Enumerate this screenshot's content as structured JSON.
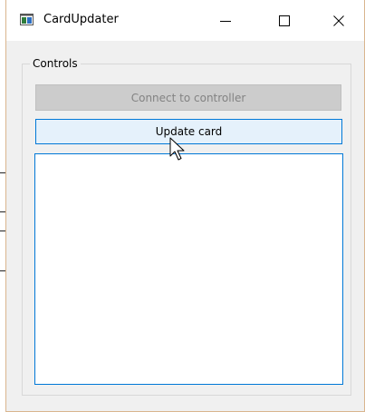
{
  "window": {
    "title": "CardUpdater",
    "icons": {
      "app": "app-window-icon",
      "minimize": "minimize-icon",
      "maximize": "maximize-icon",
      "close": "close-icon",
      "cursor": "mouse-pointer-icon"
    }
  },
  "controls": {
    "group_title": "Controls",
    "connect_button_label": "Connect to controller",
    "update_button_label": "Update card",
    "output_text": ""
  },
  "colors": {
    "accent": "#0078d7",
    "hover_fill": "#e5f1fb",
    "disabled_fill": "#cccccc",
    "disabled_text": "#838383",
    "window_background": "#f0f0f0"
  }
}
